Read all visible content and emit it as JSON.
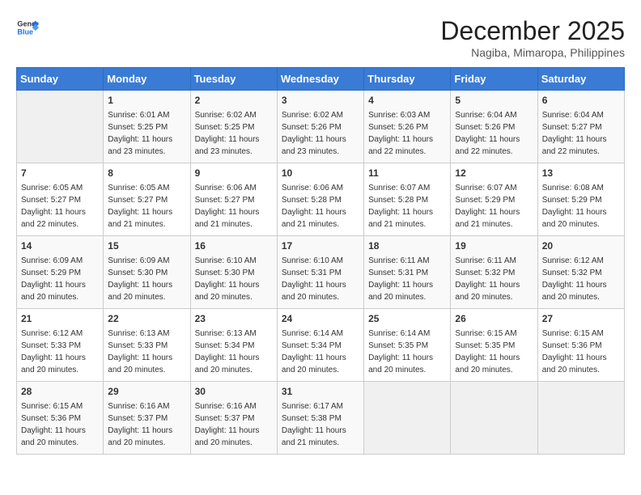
{
  "header": {
    "logo_line1": "General",
    "logo_line2": "Blue",
    "title": "December 2025",
    "subtitle": "Nagiba, Mimaropa, Philippines"
  },
  "calendar": {
    "days_of_week": [
      "Sunday",
      "Monday",
      "Tuesday",
      "Wednesday",
      "Thursday",
      "Friday",
      "Saturday"
    ],
    "weeks": [
      [
        {
          "day": "",
          "info": ""
        },
        {
          "day": "1",
          "info": "Sunrise: 6:01 AM\nSunset: 5:25 PM\nDaylight: 11 hours\nand 23 minutes."
        },
        {
          "day": "2",
          "info": "Sunrise: 6:02 AM\nSunset: 5:25 PM\nDaylight: 11 hours\nand 23 minutes."
        },
        {
          "day": "3",
          "info": "Sunrise: 6:02 AM\nSunset: 5:26 PM\nDaylight: 11 hours\nand 23 minutes."
        },
        {
          "day": "4",
          "info": "Sunrise: 6:03 AM\nSunset: 5:26 PM\nDaylight: 11 hours\nand 22 minutes."
        },
        {
          "day": "5",
          "info": "Sunrise: 6:04 AM\nSunset: 5:26 PM\nDaylight: 11 hours\nand 22 minutes."
        },
        {
          "day": "6",
          "info": "Sunrise: 6:04 AM\nSunset: 5:27 PM\nDaylight: 11 hours\nand 22 minutes."
        }
      ],
      [
        {
          "day": "7",
          "info": "Sunrise: 6:05 AM\nSunset: 5:27 PM\nDaylight: 11 hours\nand 22 minutes."
        },
        {
          "day": "8",
          "info": "Sunrise: 6:05 AM\nSunset: 5:27 PM\nDaylight: 11 hours\nand 21 minutes."
        },
        {
          "day": "9",
          "info": "Sunrise: 6:06 AM\nSunset: 5:27 PM\nDaylight: 11 hours\nand 21 minutes."
        },
        {
          "day": "10",
          "info": "Sunrise: 6:06 AM\nSunset: 5:28 PM\nDaylight: 11 hours\nand 21 minutes."
        },
        {
          "day": "11",
          "info": "Sunrise: 6:07 AM\nSunset: 5:28 PM\nDaylight: 11 hours\nand 21 minutes."
        },
        {
          "day": "12",
          "info": "Sunrise: 6:07 AM\nSunset: 5:29 PM\nDaylight: 11 hours\nand 21 minutes."
        },
        {
          "day": "13",
          "info": "Sunrise: 6:08 AM\nSunset: 5:29 PM\nDaylight: 11 hours\nand 20 minutes."
        }
      ],
      [
        {
          "day": "14",
          "info": "Sunrise: 6:09 AM\nSunset: 5:29 PM\nDaylight: 11 hours\nand 20 minutes."
        },
        {
          "day": "15",
          "info": "Sunrise: 6:09 AM\nSunset: 5:30 PM\nDaylight: 11 hours\nand 20 minutes."
        },
        {
          "day": "16",
          "info": "Sunrise: 6:10 AM\nSunset: 5:30 PM\nDaylight: 11 hours\nand 20 minutes."
        },
        {
          "day": "17",
          "info": "Sunrise: 6:10 AM\nSunset: 5:31 PM\nDaylight: 11 hours\nand 20 minutes."
        },
        {
          "day": "18",
          "info": "Sunrise: 6:11 AM\nSunset: 5:31 PM\nDaylight: 11 hours\nand 20 minutes."
        },
        {
          "day": "19",
          "info": "Sunrise: 6:11 AM\nSunset: 5:32 PM\nDaylight: 11 hours\nand 20 minutes."
        },
        {
          "day": "20",
          "info": "Sunrise: 6:12 AM\nSunset: 5:32 PM\nDaylight: 11 hours\nand 20 minutes."
        }
      ],
      [
        {
          "day": "21",
          "info": "Sunrise: 6:12 AM\nSunset: 5:33 PM\nDaylight: 11 hours\nand 20 minutes."
        },
        {
          "day": "22",
          "info": "Sunrise: 6:13 AM\nSunset: 5:33 PM\nDaylight: 11 hours\nand 20 minutes."
        },
        {
          "day": "23",
          "info": "Sunrise: 6:13 AM\nSunset: 5:34 PM\nDaylight: 11 hours\nand 20 minutes."
        },
        {
          "day": "24",
          "info": "Sunrise: 6:14 AM\nSunset: 5:34 PM\nDaylight: 11 hours\nand 20 minutes."
        },
        {
          "day": "25",
          "info": "Sunrise: 6:14 AM\nSunset: 5:35 PM\nDaylight: 11 hours\nand 20 minutes."
        },
        {
          "day": "26",
          "info": "Sunrise: 6:15 AM\nSunset: 5:35 PM\nDaylight: 11 hours\nand 20 minutes."
        },
        {
          "day": "27",
          "info": "Sunrise: 6:15 AM\nSunset: 5:36 PM\nDaylight: 11 hours\nand 20 minutes."
        }
      ],
      [
        {
          "day": "28",
          "info": "Sunrise: 6:15 AM\nSunset: 5:36 PM\nDaylight: 11 hours\nand 20 minutes."
        },
        {
          "day": "29",
          "info": "Sunrise: 6:16 AM\nSunset: 5:37 PM\nDaylight: 11 hours\nand 20 minutes."
        },
        {
          "day": "30",
          "info": "Sunrise: 6:16 AM\nSunset: 5:37 PM\nDaylight: 11 hours\nand 20 minutes."
        },
        {
          "day": "31",
          "info": "Sunrise: 6:17 AM\nSunset: 5:38 PM\nDaylight: 11 hours\nand 21 minutes."
        },
        {
          "day": "",
          "info": ""
        },
        {
          "day": "",
          "info": ""
        },
        {
          "day": "",
          "info": ""
        }
      ]
    ]
  }
}
